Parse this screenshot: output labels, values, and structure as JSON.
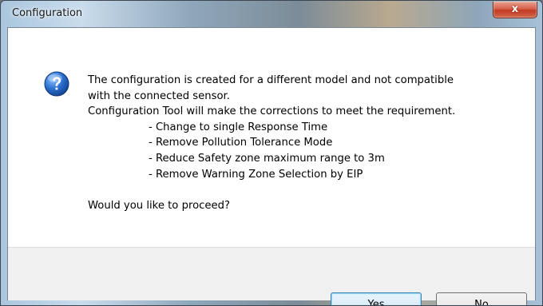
{
  "window": {
    "title": "Configuration",
    "close_label": "x"
  },
  "dialog": {
    "icon": "question-icon",
    "message_lines": [
      "The configuration is created for a different model and not compatible",
      "with the connected sensor.",
      "Configuration Tool will make the corrections to meet the requirement."
    ],
    "items": [
      "- Change to single Response Time",
      "- Remove Pollution Tolerance Mode",
      "- Reduce Safety zone maximum range to 3m",
      "- Remove Warning Zone Selection by EIP"
    ],
    "prompt": "Would you like to proceed?"
  },
  "buttons": {
    "yes_label": "Yes",
    "no_mnemonic": "N",
    "no_rest": "o"
  },
  "colors": {
    "icon_blue": "#1f5fb0",
    "default_button_border": "#3c7fb1",
    "close_red": "#c23a22"
  }
}
